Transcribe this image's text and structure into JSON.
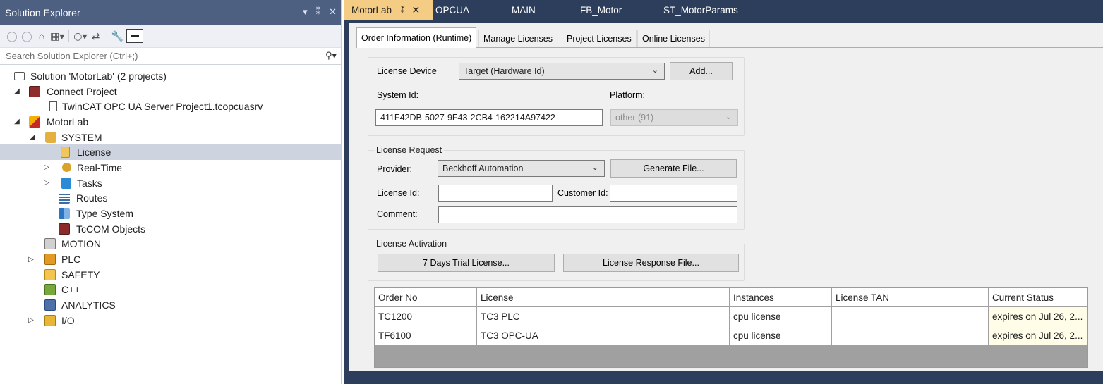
{
  "solution_explorer": {
    "title": "Solution Explorer",
    "title_controls": [
      "▾",
      "⁑",
      "✕"
    ],
    "search_placeholder": "Search Solution Explorer (Ctrl+;)",
    "tree": [
      {
        "label": "Solution 'MotorLab' (2 projects)",
        "icon": "solution-icon",
        "expander": ""
      },
      {
        "label": "Connect Project",
        "icon": "connect-project-icon",
        "expander": "◢"
      },
      {
        "label": "TwinCAT OPC UA Server Project1.tcopcuasrv",
        "icon": "file-icon",
        "expander": ""
      },
      {
        "label": "MotorLab",
        "icon": "twincat-project-icon",
        "expander": "◢"
      },
      {
        "label": "SYSTEM",
        "icon": "system-icon",
        "expander": "◢"
      },
      {
        "label": "License",
        "icon": "license-icon",
        "expander": ""
      },
      {
        "label": "Real-Time",
        "icon": "realtime-icon",
        "expander": "▷"
      },
      {
        "label": "Tasks",
        "icon": "tasks-icon",
        "expander": "▷"
      },
      {
        "label": "Routes",
        "icon": "routes-icon",
        "expander": ""
      },
      {
        "label": "Type System",
        "icon": "type-system-icon",
        "expander": ""
      },
      {
        "label": "TcCOM Objects",
        "icon": "tccom-icon",
        "expander": ""
      },
      {
        "label": "MOTION",
        "icon": "motion-icon",
        "expander": ""
      },
      {
        "label": "PLC",
        "icon": "plc-icon",
        "expander": "▷"
      },
      {
        "label": "SAFETY",
        "icon": "safety-icon",
        "expander": ""
      },
      {
        "label": "C++",
        "icon": "cpp-icon",
        "expander": ""
      },
      {
        "label": "ANALYTICS",
        "icon": "analytics-icon",
        "expander": ""
      },
      {
        "label": "I/O",
        "icon": "io-icon",
        "expander": "▷"
      }
    ]
  },
  "doc_tabs": [
    "MotorLab",
    "OPCUA",
    "MAIN",
    "FB_Motor",
    "ST_MotorParams"
  ],
  "doc_tab_pin": "⁑",
  "doc_tab_close": "✕",
  "page_tabs": [
    "Order Information (Runtime)",
    "Manage Licenses",
    "Project Licenses",
    "Online Licenses"
  ],
  "device": {
    "license_device_label": "License Device",
    "license_device_value": "Target (Hardware Id)",
    "add_button": "Add...",
    "system_id_label": "System Id:",
    "system_id_value": "411F42DB-5027-9F43-2CB4-162214A97422",
    "platform_label": "Platform:",
    "platform_value": "other (91)"
  },
  "request": {
    "group_label": "License Request",
    "provider_label": "Provider:",
    "provider_value": "Beckhoff Automation",
    "generate_button": "Generate File...",
    "license_id_label": "License Id:",
    "license_id_value": "",
    "customer_id_label": "Customer Id:",
    "customer_id_value": "",
    "comment_label": "Comment:",
    "comment_value": ""
  },
  "activation": {
    "group_label": "License Activation",
    "trial_button": "7 Days Trial License...",
    "response_button": "License Response File..."
  },
  "grid": {
    "columns": [
      "Order No",
      "License",
      "Instances",
      "License TAN",
      "Current Status"
    ],
    "rows": [
      [
        "TC1200",
        "TC3 PLC",
        "cpu license",
        "",
        "expires on Jul 26, 2..."
      ],
      [
        "TF6100",
        "TC3 OPC-UA",
        "cpu license",
        "",
        "expires on Jul 26, 2..."
      ]
    ]
  },
  "colors": {
    "se_title_bg": "#4d6082",
    "doc_bg": "#2c3e5c",
    "active_tab": "#f5cc84",
    "selected_row": "#cdd3df"
  }
}
